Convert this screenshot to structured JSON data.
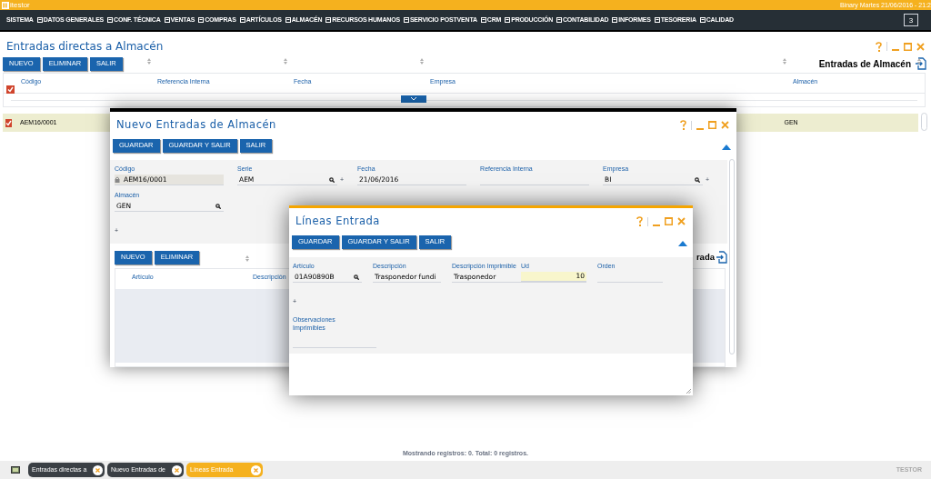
{
  "app": {
    "logo": "itestor",
    "user_info": "Binary Martes 21/06/2016 - 21:2"
  },
  "menu": [
    {
      "label": "SISTEMA",
      "kind": "plain"
    },
    {
      "label": "DATOS GENERALES",
      "kind": "icon"
    },
    {
      "label": "CONF. TÉCNICA",
      "kind": "icon"
    },
    {
      "label": "VENTAS",
      "kind": "icon"
    },
    {
      "label": "COMPRAS",
      "kind": "icon"
    },
    {
      "label": "ARTÍCULOS",
      "kind": "icon"
    },
    {
      "label": "ALMACÉN",
      "kind": "icon"
    },
    {
      "label": "RECURSOS HUMANOS",
      "kind": "icon"
    },
    {
      "label": "SERVICIO POSTVENTA",
      "kind": "icon"
    },
    {
      "label": "CRM",
      "kind": "icon"
    },
    {
      "label": "PRODUCCIÓN",
      "kind": "icon"
    },
    {
      "label": "CONTABILIDAD",
      "kind": "icon"
    },
    {
      "label": "INFORMES",
      "kind": "icon"
    },
    {
      "label": "TESORERIA",
      "kind": "icon"
    },
    {
      "label": "CALIDAD",
      "kind": "icon"
    }
  ],
  "window_count": "3",
  "main": {
    "title": "Entradas directas a Almacén",
    "buttons": [
      "NUEVO",
      "ELIMINAR",
      "SALIR"
    ],
    "heading": "Entradas de Almacén",
    "table": {
      "select_all_checked": true,
      "columns": [
        "Código",
        "Referencia Interna",
        "Fecha",
        "Empresa",
        "Almacén"
      ],
      "rows": [
        {
          "checked": true,
          "selected": true,
          "codigo": "AEM16/0001",
          "almacen": "GEN"
        }
      ]
    }
  },
  "status": "Mostrando registros: 0. Total: 0 registros.",
  "windows": [
    {
      "title": "Nuevo Entradas de Almacén",
      "buttons": [
        "GUARDAR",
        "GUARDAR Y SALIR",
        "SALIR"
      ],
      "fields": [
        {
          "label": "Código",
          "value": "AEM16/0001",
          "locked": true
        },
        {
          "label": "Serie",
          "value": "AEM",
          "lookup": true,
          "add": "+"
        },
        {
          "label": "Fecha",
          "value": "21/06/2016"
        },
        {
          "label": "Referencia Interna"
        },
        {
          "label": "Empresa",
          "value": "BI",
          "lookup": true,
          "add": "+"
        },
        {
          "label": "Almacén",
          "value": "GEN",
          "lookup": true
        }
      ],
      "add_line": "+",
      "lines": {
        "buttons": [
          "NUEVO",
          "ELIMINAR"
        ],
        "heading": "rada",
        "columns": [
          "Artículo",
          "Descripción"
        ]
      }
    },
    {
      "title": "Líneas Entrada",
      "buttons": [
        "GUARDAR",
        "GUARDAR Y SALIR",
        "SALIR"
      ],
      "fields": [
        {
          "label": "Artículo",
          "value": "01A90890B",
          "lookup": true
        },
        {
          "label": "Descripción",
          "value": "Trasponedor fundi"
        },
        {
          "label": "Descripción Imprimible",
          "value": "Trasponedor"
        },
        {
          "label": "Ud",
          "value": "10",
          "focused": true
        },
        {
          "label": "Orden"
        },
        {
          "label": "Observaciones Imprimibles"
        }
      ],
      "add_line": "+"
    }
  ],
  "taskbar": [
    {
      "label": "Entradas directas a",
      "selected": false
    },
    {
      "label": "Nuevo Entradas de",
      "selected": false
    },
    {
      "label": "Líneas Entrada",
      "selected": true
    }
  ],
  "brand": "TESTOR"
}
